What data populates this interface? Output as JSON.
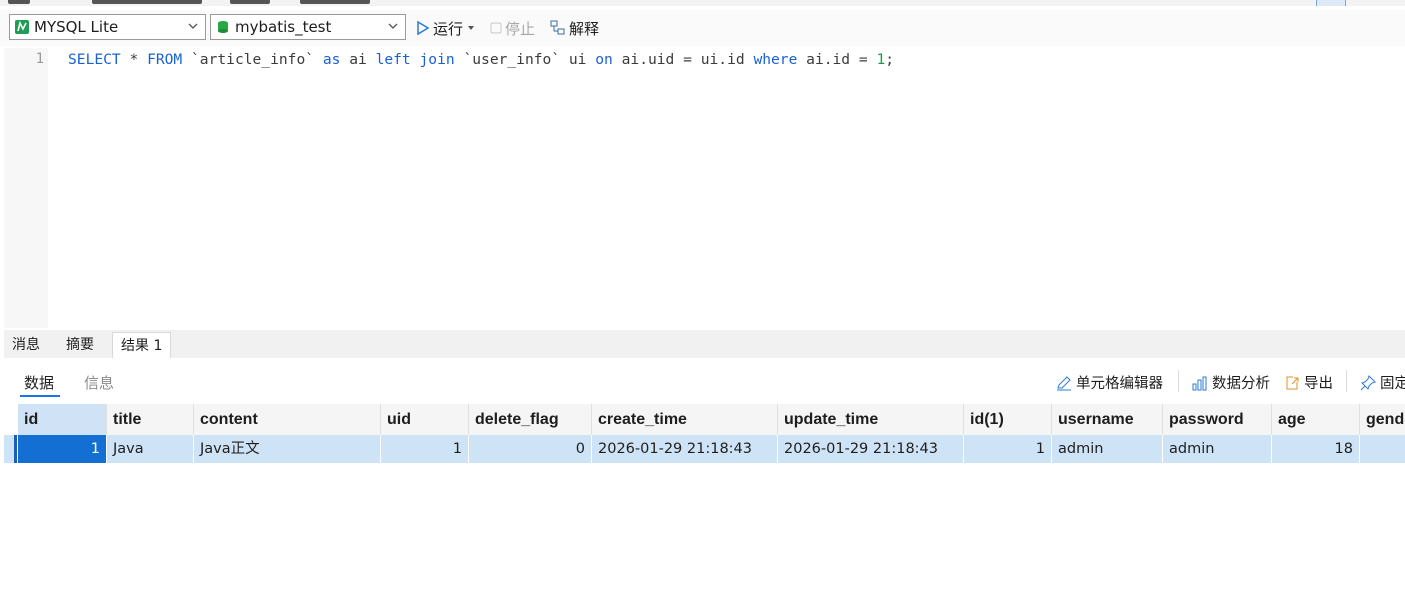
{
  "toolbar": {
    "connection": "MYSQL Lite",
    "database": "mybatis_test",
    "run_label": "运行",
    "stop_label": "停止",
    "explain_label": "解释"
  },
  "editor": {
    "line_number": "1",
    "query_tokens": [
      {
        "text": "SELECT",
        "kind": "kw"
      },
      {
        "text": " * ",
        "kind": "plain"
      },
      {
        "text": "FROM",
        "kind": "kw"
      },
      {
        "text": " `article_info` ",
        "kind": "plain"
      },
      {
        "text": "as",
        "kind": "kw"
      },
      {
        "text": " ai ",
        "kind": "plain"
      },
      {
        "text": "left",
        "kind": "kw"
      },
      {
        "text": " ",
        "kind": "plain"
      },
      {
        "text": "join",
        "kind": "kw"
      },
      {
        "text": " `user_info` ui ",
        "kind": "plain"
      },
      {
        "text": "on",
        "kind": "kw"
      },
      {
        "text": " ai.uid = ui.id ",
        "kind": "plain"
      },
      {
        "text": "where",
        "kind": "kw"
      },
      {
        "text": " ai.id = ",
        "kind": "plain"
      },
      {
        "text": "1",
        "kind": "num"
      },
      {
        "text": ";",
        "kind": "plain"
      }
    ]
  },
  "result_tabs": [
    "消息",
    "摘要",
    "结果 1"
  ],
  "active_result_tab": "结果 1",
  "sub_tabs": {
    "data": "数据",
    "info": "信息"
  },
  "actions": {
    "cell_editor": "单元格编辑器",
    "data_analysis": "数据分析",
    "export": "导出",
    "pin": "固定"
  },
  "grid": {
    "columns": [
      "id",
      "title",
      "content",
      "uid",
      "delete_flag",
      "create_time",
      "update_time",
      "id(1)",
      "username",
      "password",
      "age",
      "gender"
    ],
    "rows": [
      [
        "1",
        "Java",
        "Java正文",
        "1",
        "0",
        "2026-01-29 21:18:43",
        "2026-01-29 21:18:43",
        "1",
        "admin",
        "admin",
        "18",
        ""
      ]
    ]
  },
  "colors": {
    "accent": "#1a73e8",
    "selected_cell": "#1370d2",
    "row_highlight": "#cfe3f6",
    "keyword": "#1a62d4",
    "number": "#1a9a4a"
  }
}
